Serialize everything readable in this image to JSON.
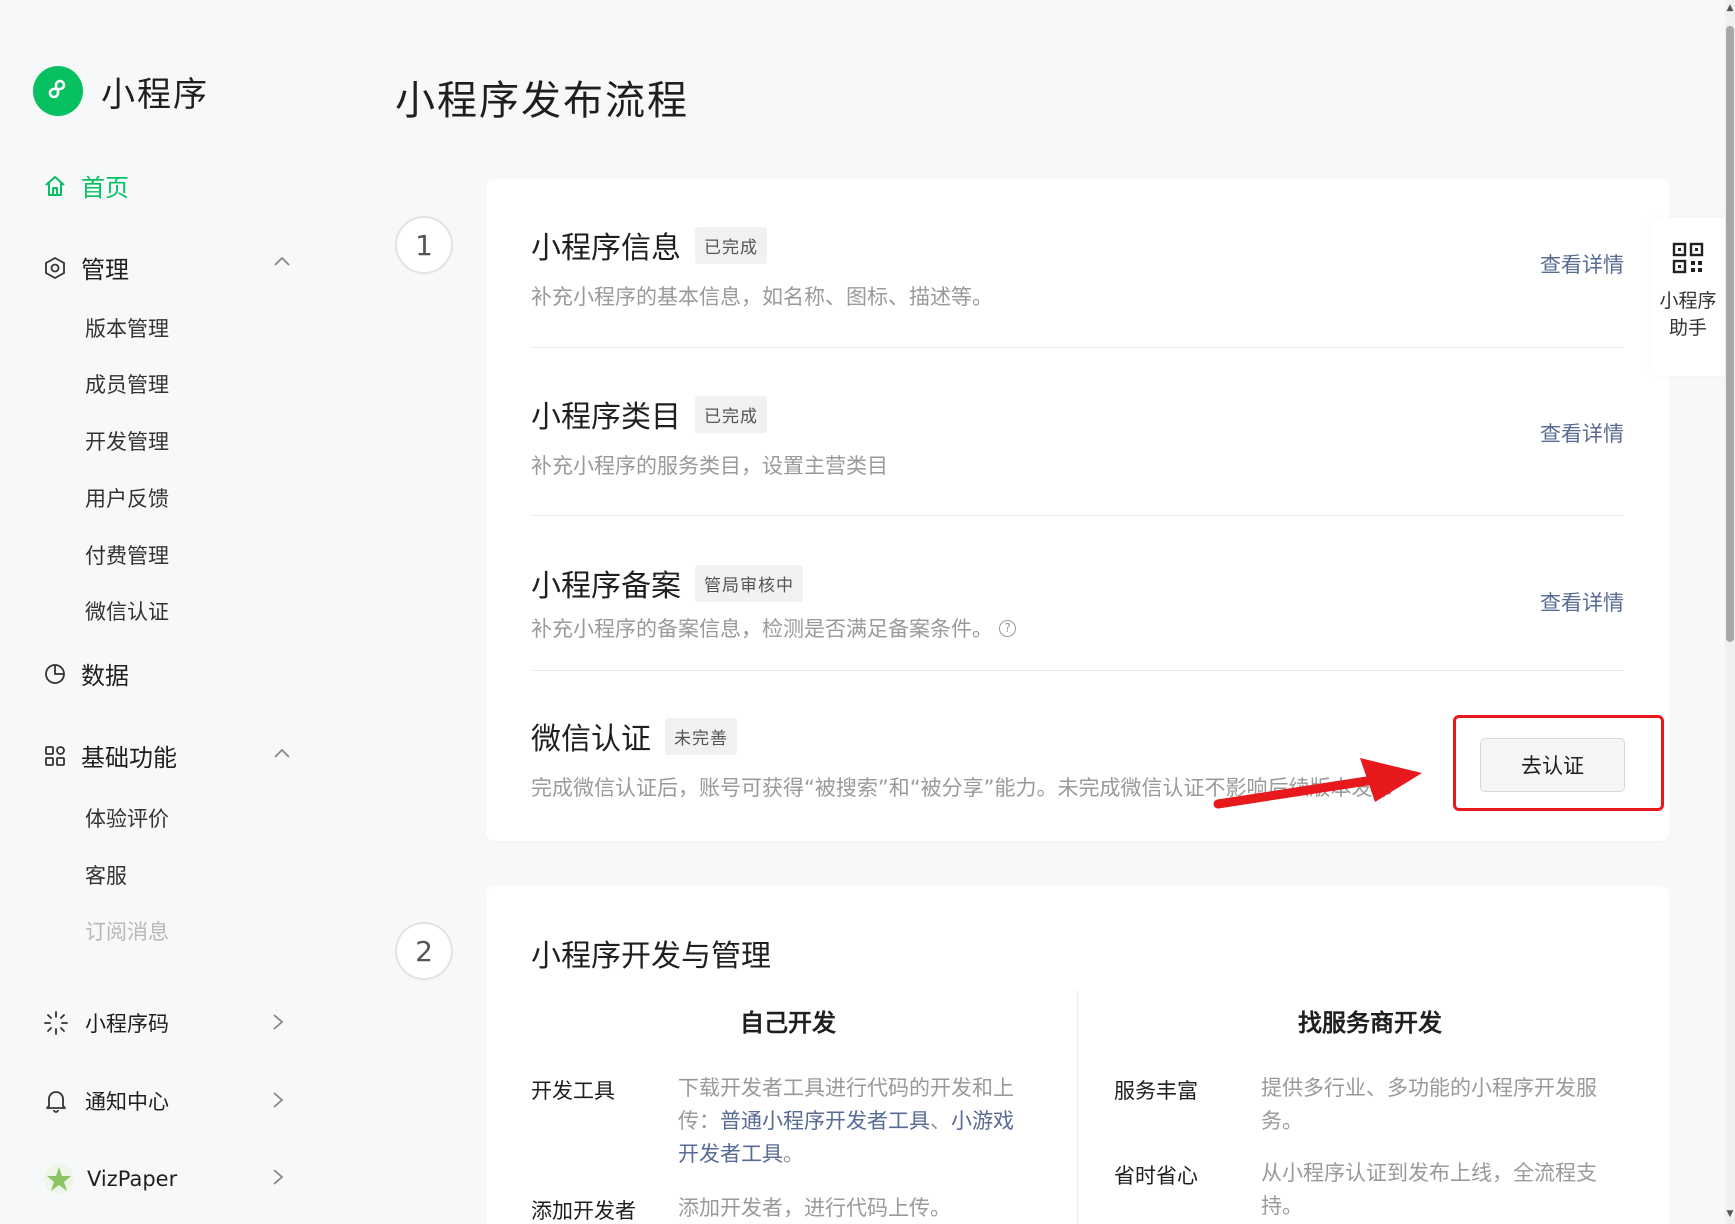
{
  "sidebar": {
    "logo_text": "小程序",
    "home": "首页",
    "manage": {
      "label": "管理",
      "items": [
        "版本管理",
        "成员管理",
        "开发管理",
        "用户反馈",
        "付费管理",
        "微信认证"
      ]
    },
    "data": "数据",
    "basic": {
      "label": "基础功能",
      "items": [
        "体验评价",
        "客服",
        "订阅消息"
      ]
    },
    "bottom": [
      "小程序码",
      "通知中心",
      "VizPaper"
    ]
  },
  "page_title": "小程序发布流程",
  "steps": [
    "1",
    "2"
  ],
  "step1": {
    "rows": [
      {
        "title": "小程序信息",
        "tag": "已完成",
        "desc": "补充小程序的基本信息，如名称、图标、描述等。",
        "link": "查看详情"
      },
      {
        "title": "小程序类目",
        "tag": "已完成",
        "desc": "补充小程序的服务类目，设置主营类目",
        "link": "查看详情"
      },
      {
        "title": "小程序备案",
        "tag": "管局审核中",
        "desc": "补充小程序的备案信息，检测是否满足备案条件。",
        "link": "查看详情"
      },
      {
        "title": "微信认证",
        "tag": "未完善",
        "desc": "完成微信认证后，账号可获得“被搜索”和“被分享”能力。未完成微信认证不影响后续版本发布",
        "button": "去认证"
      }
    ]
  },
  "step2": {
    "title": "小程序开发与管理",
    "left": {
      "title": "自己开发",
      "items": [
        {
          "key": "开发工具",
          "val_pre": "下载开发者工具进行代码的开发和上传：",
          "link1": "普通小程序开发者工具",
          "sep": "、",
          "link2": "小游戏开发者工具",
          "val_post": "。"
        },
        {
          "key": "添加开发者",
          "val": "添加开发者，进行代码上传。"
        }
      ]
    },
    "right": {
      "title": "找服务商开发",
      "items": [
        {
          "key": "服务丰富",
          "val": "提供多行业、多功能的小程序开发服务。"
        },
        {
          "key": "省时省心",
          "val": "从小程序认证到发布上线，全流程支持。"
        }
      ]
    }
  },
  "helper": {
    "label": "小程序助手"
  },
  "colors": {
    "brand": "#07c160",
    "link": "#576b95",
    "annotation": "#e8191c"
  }
}
